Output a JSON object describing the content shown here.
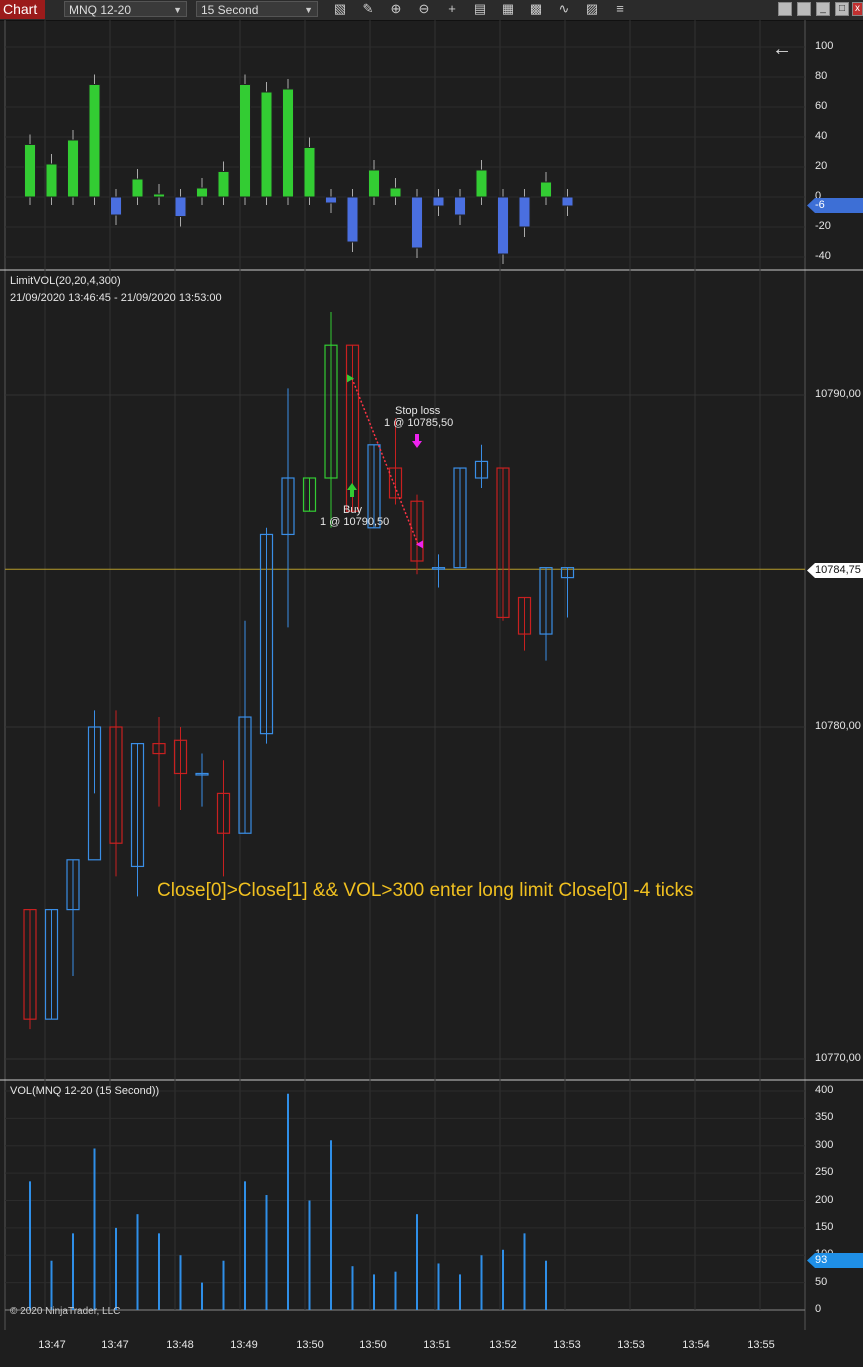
{
  "toolbar": {
    "tab_label": "Chart",
    "instrument": "MNQ 12-20",
    "interval": "15 Second",
    "tools": [
      "bar-chart-icon",
      "pencil-icon",
      "zoom-in-icon",
      "zoom-out-icon",
      "crosshair-icon",
      "properties-icon",
      "data-box-icon",
      "indicators-icon",
      "strategies-icon",
      "attach-icon",
      "list-icon"
    ]
  },
  "top_panel": {
    "axis_ticks": [
      "100",
      "80",
      "60",
      "40",
      "20",
      "0",
      "-20",
      "-40"
    ],
    "current_value": "-6",
    "values": [
      35,
      22,
      38,
      75,
      -12,
      12,
      2,
      -13,
      6,
      17,
      75,
      70,
      72,
      33,
      -4,
      -30,
      18,
      6,
      -34,
      -6,
      -12,
      18,
      -38,
      -20,
      10,
      -6
    ]
  },
  "price_panel": {
    "title": "LimitVOL(20,20,4,300)",
    "range": "21/09/2020 13:46:45 - 21/09/2020 13:53:00",
    "axis_ticks": [
      "10790,00",
      "10780,00",
      "10770,00"
    ],
    "last_price": "10784,75",
    "annotation": "Close[0]>Close[1] && VOL>300 enter long limit Close[0] -4 ticks",
    "buy_label": "Buy",
    "buy_detail": "1 @ 10790,50",
    "stop_label": "Stop loss",
    "stop_detail": "1 @ 10785,50",
    "colors": {
      "up": "#3a8ee6",
      "down": "#c82020",
      "signal": "#33cc33",
      "exit": "#ee22ee",
      "last_line": "#b59b2a"
    }
  },
  "vol_panel": {
    "title": "VOL(MNQ 12-20 (15 Second))",
    "axis_ticks": [
      "400",
      "350",
      "300",
      "250",
      "200",
      "150",
      "100",
      "50",
      "0"
    ],
    "current_value": "93",
    "values": [
      235,
      90,
      140,
      295,
      150,
      175,
      140,
      100,
      50,
      90,
      235,
      210,
      395,
      200,
      310,
      80,
      65,
      70,
      175,
      85,
      65,
      100,
      110,
      140,
      90
    ],
    "copyright": "© 2020 NinjaTrader, LLC"
  },
  "time_axis": [
    "13:47",
    "13:47",
    "13:48",
    "13:49",
    "13:50",
    "13:50",
    "13:51",
    "13:52",
    "13:53",
    "13:53",
    "13:54",
    "13:55"
  ],
  "chart_data": {
    "type": "candlestick",
    "ohlc": [
      [
        10774.5,
        10774.5,
        10770.9,
        10771.2
      ],
      [
        10771.2,
        10774.5,
        10771.2,
        10774.5
      ],
      [
        10774.5,
        10776.0,
        10772.5,
        10776.0
      ],
      [
        10776.0,
        10780.5,
        10778.0,
        10780.0
      ],
      [
        10780.0,
        10780.5,
        10775.5,
        10776.5
      ],
      [
        10775.8,
        10779.5,
        10774.9,
        10779.5
      ],
      [
        10779.5,
        10780.3,
        10777.6,
        10779.2
      ],
      [
        10779.6,
        10780.0,
        10777.5,
        10778.6
      ],
      [
        10778.6,
        10779.2,
        10777.6,
        10778.6
      ],
      [
        10778.0,
        10779.0,
        10775.5,
        10776.8
      ],
      [
        10776.8,
        10783.2,
        10776.8,
        10780.3
      ],
      [
        10779.8,
        10786.0,
        10779.5,
        10785.8
      ],
      [
        10785.8,
        10790.2,
        10783.0,
        10787.5
      ],
      [
        10786.5,
        10787.5,
        10786.5,
        10787.5
      ],
      [
        10787.5,
        10792.5,
        10786.0,
        10791.5
      ],
      [
        10791.5,
        10791.5,
        10786.5,
        10786.5
      ],
      [
        10786.0,
        10788.5,
        10786.0,
        10788.5
      ],
      [
        10787.8,
        10789.3,
        10786.7,
        10786.9
      ],
      [
        10786.8,
        10787.0,
        10784.6,
        10785.0
      ],
      [
        10784.8,
        10785.2,
        10784.2,
        10784.8
      ],
      [
        10784.8,
        10787.8,
        10784.8,
        10787.8
      ],
      [
        10787.5,
        10788.5,
        10787.2,
        10788.0
      ],
      [
        10787.8,
        10787.8,
        10783.2,
        10783.3
      ],
      [
        10783.9,
        10783.9,
        10782.3,
        10782.8
      ],
      [
        10782.8,
        10784.8,
        10782.0,
        10784.8
      ],
      [
        10784.5,
        10784.8,
        10783.3,
        10784.8
      ]
    ]
  }
}
